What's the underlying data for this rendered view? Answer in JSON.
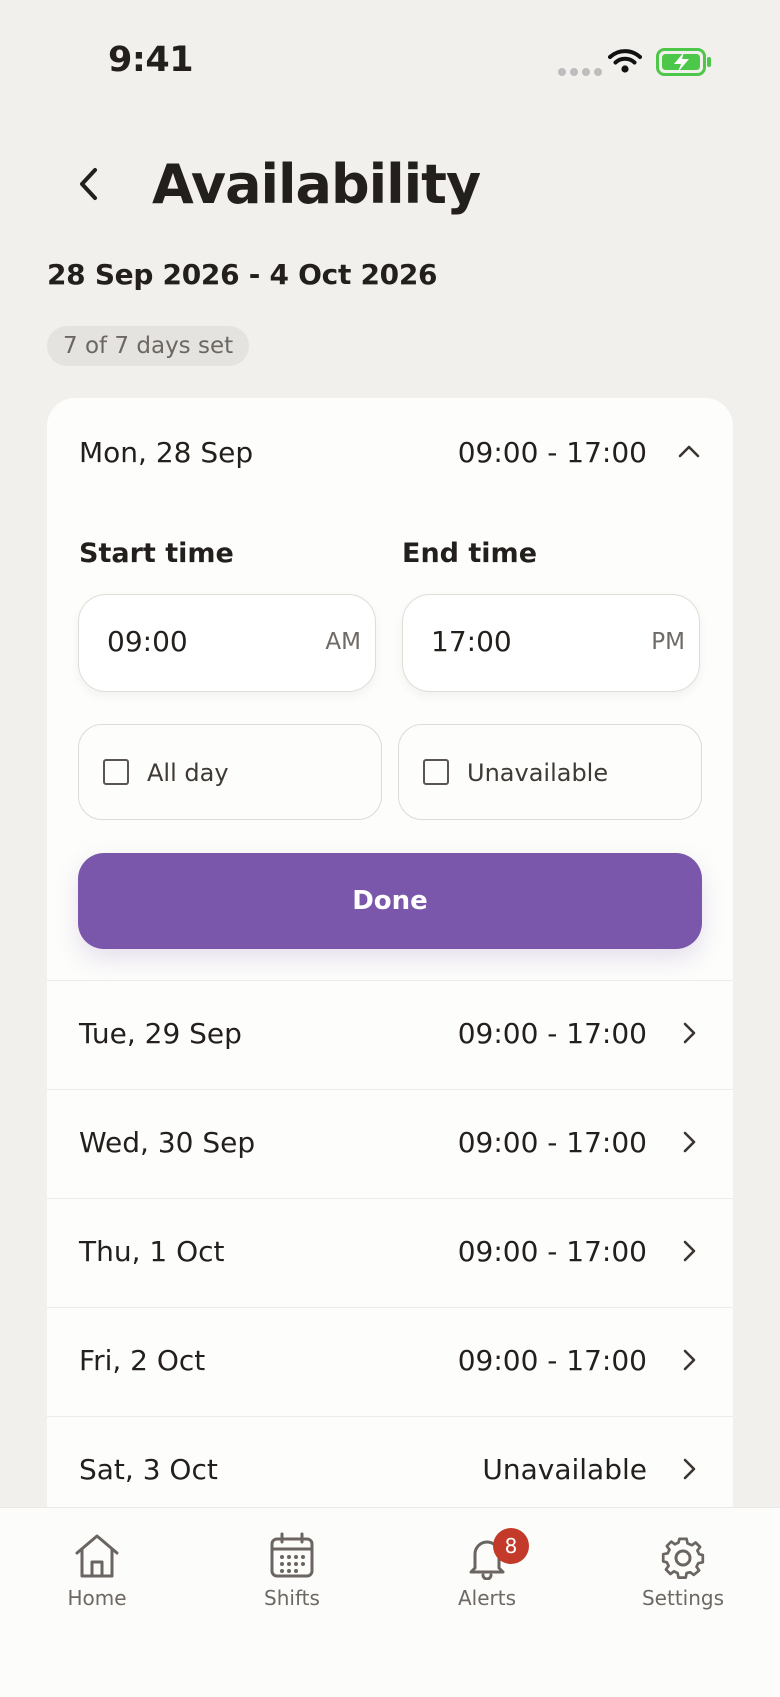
{
  "status_bar": {
    "time": "9:41"
  },
  "header": {
    "title": "Availability",
    "back_icon": "chevron-left-icon"
  },
  "date_range": "28 Sep 2026 - 4 Oct 2026",
  "days_set": "7 of 7 days set",
  "expanded_day": {
    "name": "Mon, 28 Sep",
    "time": "09:00 - 17:00",
    "icon": "chevron-up-icon",
    "start": {
      "label": "Start time",
      "value": "09:00",
      "suffix": "AM"
    },
    "end": {
      "label": "End time",
      "value": "17:00",
      "suffix": "PM"
    },
    "all_day": {
      "label": "All day",
      "checked": false
    },
    "unavailable": {
      "label": "Unavailable",
      "checked": false
    },
    "done_label": "Done"
  },
  "days": [
    {
      "name": "Tue, 29 Sep",
      "time": "09:00 - 17:00"
    },
    {
      "name": "Wed, 30 Sep",
      "time": "09:00 - 17:00"
    },
    {
      "name": "Thu, 1 Oct",
      "time": "09:00 - 17:00"
    },
    {
      "name": "Fri, 2 Oct",
      "time": "09:00 - 17:00"
    },
    {
      "name": "Sat, 3 Oct",
      "time": "Unavailable"
    }
  ],
  "tab_bar": {
    "items": [
      {
        "label": "Home",
        "icon": "home-icon"
      },
      {
        "label": "Shifts",
        "icon": "calendar-icon"
      },
      {
        "label": "Alerts",
        "icon": "bell-icon",
        "badge": "8"
      },
      {
        "label": "Settings",
        "icon": "gear-icon"
      }
    ]
  },
  "colors": {
    "accent": "#7b57ab",
    "badge": "#c43a2a",
    "background": "#f1f0ed",
    "battery": "#4cc74a"
  }
}
